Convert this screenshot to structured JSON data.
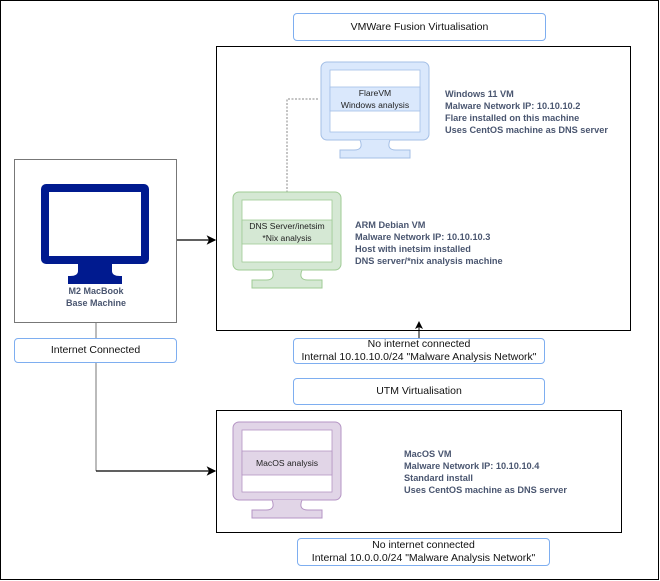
{
  "colors": {
    "label_border": "#7eaef0",
    "base_monitor": "#001a8f",
    "flare_fill": "#dae8fc",
    "flare_stroke": "#a4bfe6",
    "dns_fill": "#d5e8d4",
    "dns_stroke": "#9fcb95",
    "mac_fill": "#e1d5e7",
    "mac_stroke": "#b595c4",
    "info_text": "#4a5670"
  },
  "vmware": {
    "title": "VMWare Fusion Virtualisation",
    "network_line1": "No internet connected",
    "network_line2": "Internal 10.10.10.0/24 \"Malware Analysis Network\"",
    "flare": {
      "screen_line1": "FlareVM",
      "screen_line2": "Windows analysis",
      "info": [
        "Windows 11 VM",
        "Malware Network IP: 10.10.10.2",
        "Flare installed on this machine",
        "Uses CentOS machine as DNS server"
      ]
    },
    "dns": {
      "screen_line1": "DNS Server/inetsim",
      "screen_line2": "*Nix analysis",
      "info": [
        "ARM Debian VM",
        "Malware Network IP: 10.10.10.3",
        "Host with inetsim installed",
        "DNS server/*nix analysis machine"
      ]
    }
  },
  "base": {
    "caption_line1": "M2 MacBook",
    "caption_line2": "Base Machine",
    "internet_label": "Internet Connected"
  },
  "utm": {
    "title": "UTM Virtualisation",
    "network_line1": "No internet connected",
    "network_line2": "Internal 10.0.0.0/24 \"Malware Analysis Network\"",
    "mac": {
      "screen_line1": "MacOS analysis",
      "info": [
        "MacOS VM",
        "Malware Network IP: 10.10.10.4",
        "Standard install",
        "Uses CentOS machine as DNS server"
      ]
    }
  }
}
